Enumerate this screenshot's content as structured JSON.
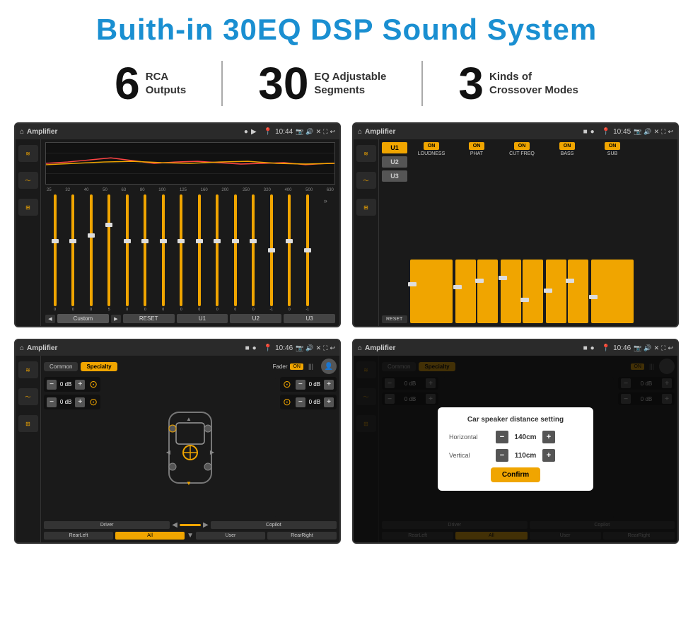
{
  "header": {
    "title": "Buith-in 30EQ DSP Sound System"
  },
  "stats": [
    {
      "number": "6",
      "label": "RCA\nOutputs"
    },
    {
      "number": "30",
      "label": "EQ Adjustable\nSegments"
    },
    {
      "number": "3",
      "label": "Kinds of\nCrossover Modes"
    }
  ],
  "screens": {
    "eq": {
      "title": "Amplifier",
      "time": "10:44",
      "frequencies": [
        "25",
        "32",
        "40",
        "50",
        "63",
        "80",
        "100",
        "125",
        "160",
        "200",
        "250",
        "320",
        "400",
        "500",
        "630"
      ],
      "values": [
        "0",
        "0",
        "0",
        "5",
        "0",
        "0",
        "0",
        "0",
        "0",
        "0",
        "0",
        "0",
        "-1",
        "0",
        "-1"
      ],
      "buttons": [
        "Custom",
        "RESET",
        "U1",
        "U2",
        "U3"
      ]
    },
    "crossover": {
      "title": "Amplifier",
      "time": "10:45",
      "uButtons": [
        "U1",
        "U2",
        "U3"
      ],
      "channels": [
        "LOUDNESS",
        "PHAT",
        "CUT FREQ",
        "BASS",
        "SUB"
      ],
      "resetLabel": "RESET"
    },
    "fader": {
      "title": "Amplifier",
      "time": "10:46",
      "tabs": [
        "Common",
        "Specialty"
      ],
      "faderLabel": "Fader",
      "onLabel": "ON",
      "driverLabel": "Driver",
      "copilotLabel": "Copilot",
      "rearLeftLabel": "RearLeft",
      "allLabel": "All",
      "userLabel": "User",
      "rearRightLabel": "RearRight",
      "dbValues": [
        "0 dB",
        "0 dB",
        "0 dB",
        "0 dB"
      ]
    },
    "dialog": {
      "title": "Amplifier",
      "time": "10:46",
      "tabs": [
        "Common",
        "Specialty"
      ],
      "dialogTitle": "Car speaker distance setting",
      "horizontal": {
        "label": "Horizontal",
        "value": "140cm"
      },
      "vertical": {
        "label": "Vertical",
        "value": "110cm"
      },
      "confirmLabel": "Confirm",
      "driverLabel": "Driver",
      "copilotLabel": "Copilot",
      "rearLeftLabel": "RearLeft",
      "allLabel": "All",
      "userLabel": "User",
      "rearRightLabel": "RearRight"
    }
  },
  "icons": {
    "home": "⌂",
    "back": "↩",
    "location": "📍",
    "camera": "📷",
    "volume": "🔊",
    "close": "✕",
    "expand": "⛶",
    "eq_icon": "≋",
    "wave_icon": "〜",
    "speaker_icon": "⊞",
    "chevron_left": "◀",
    "chevron_right": "▶",
    "chevron_up": "▲",
    "chevron_down": "▼",
    "minus": "−",
    "plus": "+"
  }
}
